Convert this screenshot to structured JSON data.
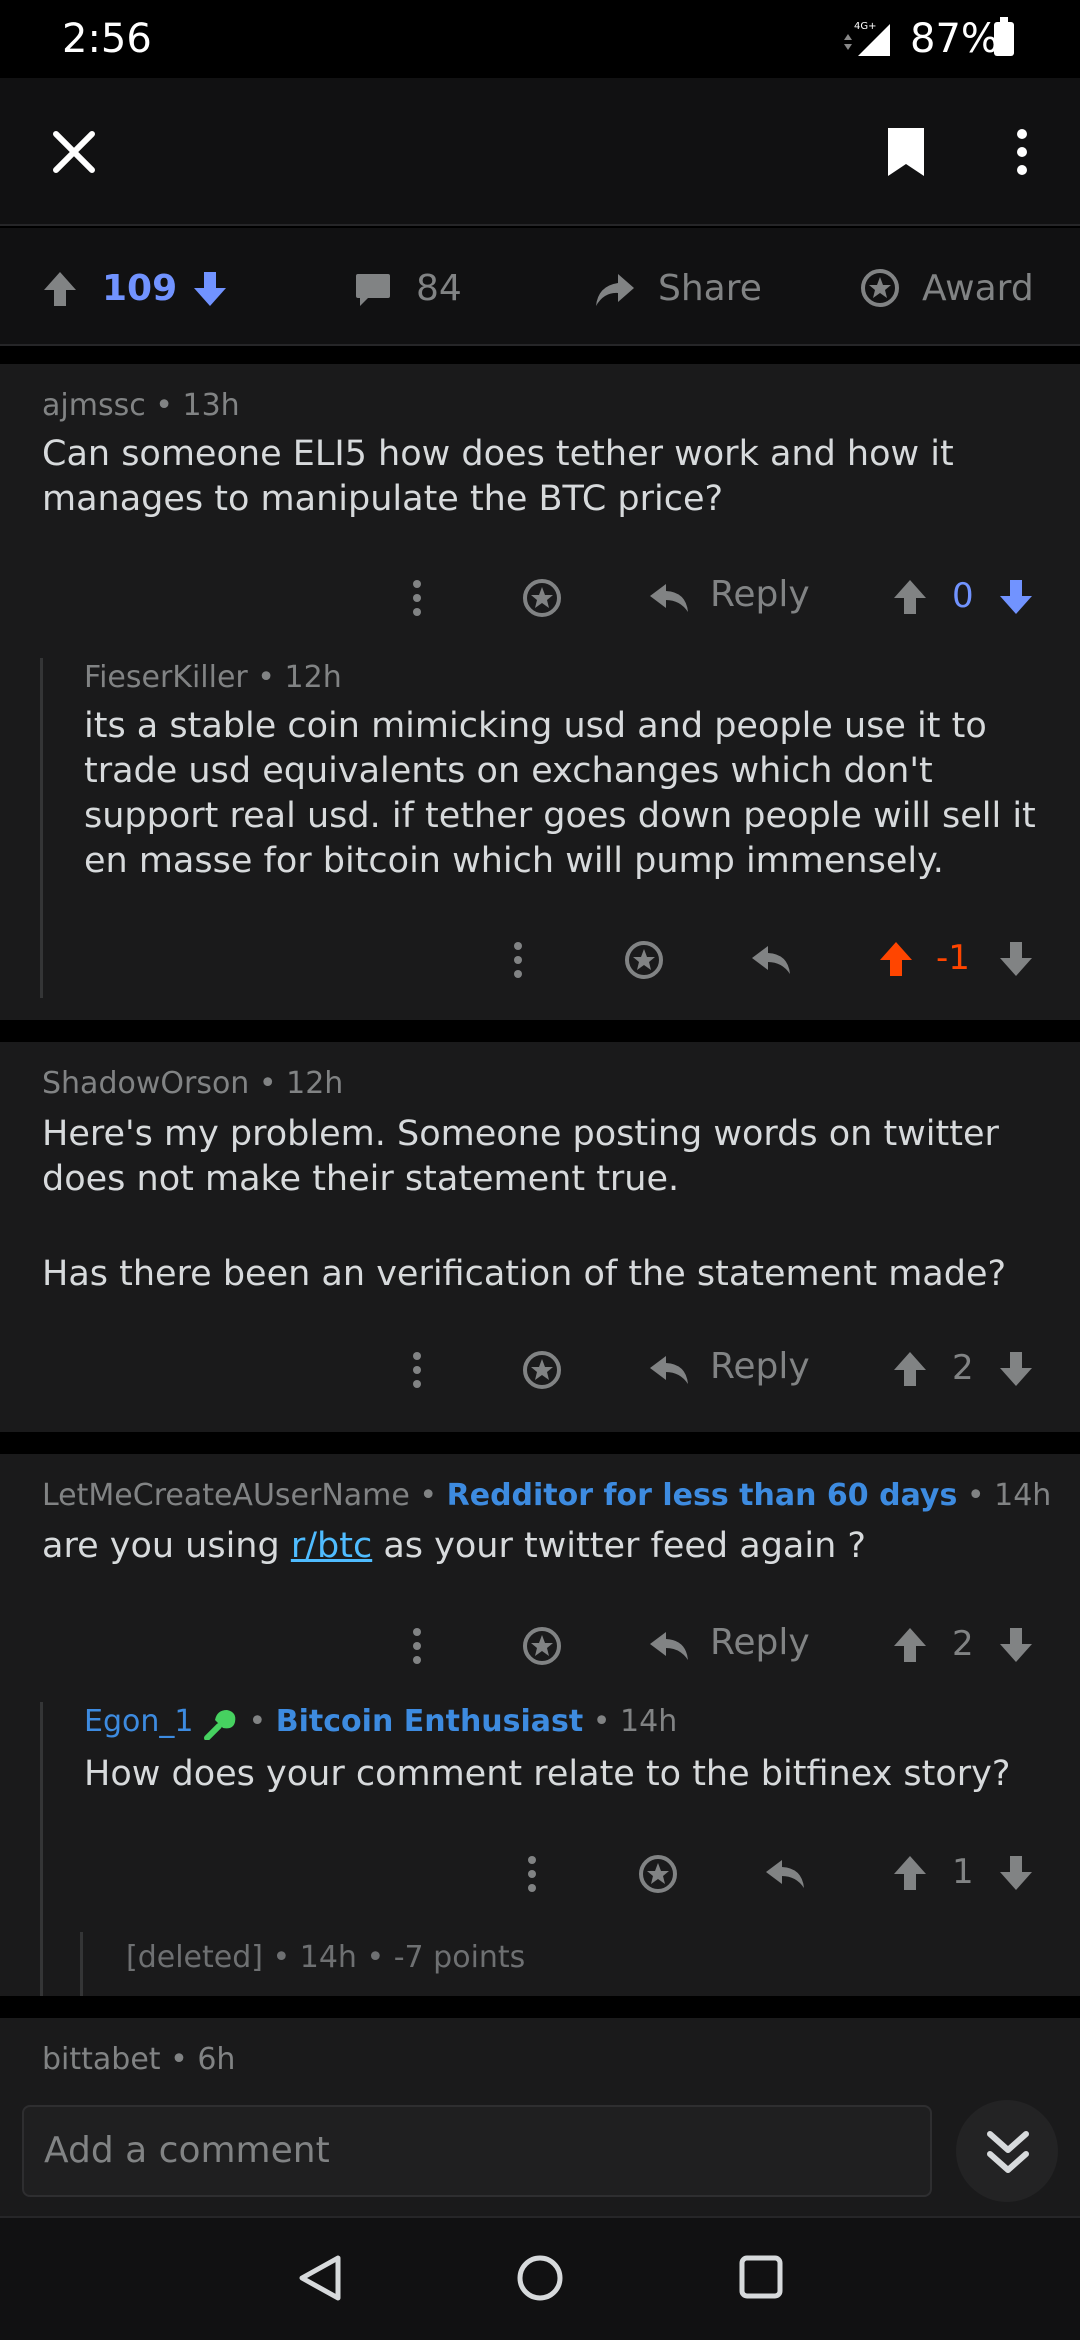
{
  "status": {
    "time": "2:56",
    "network": "4G+",
    "battery": "87%"
  },
  "post_actions": {
    "score": "109",
    "comments": "84",
    "share_label": "Share",
    "award_label": "Award"
  },
  "comments": [
    {
      "author": "ajmssc",
      "age": "13h",
      "body": "Can someone ELI5 how does tether work and how it manages to manipulate the BTC price?",
      "reply_label": "Reply",
      "score": "0"
    },
    {
      "author": "FieserKiller",
      "age": "12h",
      "body": "its a stable coin mimicking usd and people use it to trade usd equivalents on exchanges which don't support real usd. if tether goes down people will sell it en masse for bitcoin which will pump immensely.",
      "score": "-1"
    },
    {
      "author": "ShadowOrson",
      "age": "12h",
      "body_line1": "Here's my problem. Someone posting words on twitter does not make their statement true.",
      "body_line2": "Has there been an verification of the statement made?",
      "reply_label": "Reply",
      "score": "2"
    },
    {
      "author": "LetMeCreateAUserName",
      "flair": "Redditor for less than 60 days",
      "age": "14h",
      "body_pre": "are you using ",
      "body_link": "r/btc",
      "body_post": " as your twitter feed again ?",
      "reply_label": "Reply",
      "score": "2"
    },
    {
      "author": "Egon_1",
      "flair": "Bitcoin Enthusiast",
      "age": "14h",
      "body": "How does your comment relate to the bitfinex story?",
      "score": "1"
    },
    {
      "author": "[deleted]",
      "age": "14h",
      "points": "-7 points"
    },
    {
      "author": "bittabet",
      "age": "6h"
    }
  ],
  "composer": {
    "placeholder": "Add a comment"
  },
  "colors": {
    "upvote": "#ff4500",
    "downvote": "#7193ff",
    "background": "#1a1a1b"
  },
  "icons": [
    "close-icon",
    "bookmark-icon",
    "more-vert-icon",
    "upvote-icon",
    "downvote-icon",
    "comment-icon",
    "share-icon",
    "award-icon",
    "reply-icon",
    "chevrons-down-icon",
    "back-icon",
    "home-icon",
    "recents-icon"
  ]
}
